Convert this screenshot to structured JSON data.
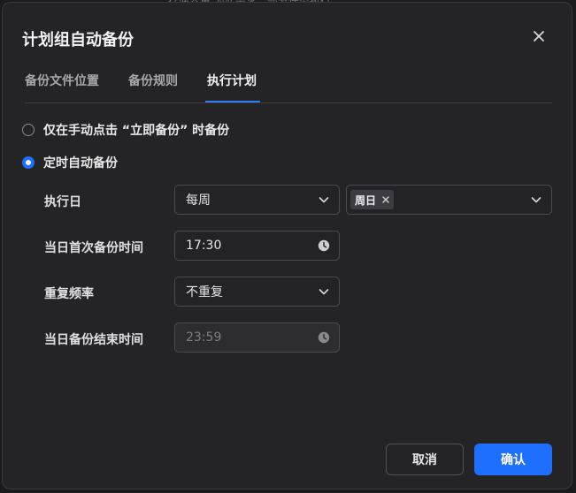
{
  "background_text": "存储容量 为此需求，部分任务执行",
  "dialog": {
    "title": "计划组自动备份",
    "close_icon": "close-icon"
  },
  "tabs": [
    {
      "label": "备份文件位置",
      "active": false
    },
    {
      "label": "备份规则",
      "active": false
    },
    {
      "label": "执行计划",
      "active": true
    }
  ],
  "options": {
    "manual": {
      "label": "仅在手动点击 “立即备份” 时备份",
      "checked": false
    },
    "scheduled": {
      "label": "定时自动备份",
      "checked": true
    }
  },
  "fields": {
    "execution_day": {
      "label": "执行日",
      "frequency_value": "每周",
      "days_selected": [
        "周日"
      ]
    },
    "first_backup_time": {
      "label": "当日首次备份时间",
      "value": "17:30"
    },
    "repeat_frequency": {
      "label": "重复频率",
      "value": "不重复"
    },
    "end_time": {
      "label": "当日备份结束时间",
      "value": "23:59",
      "disabled": true
    }
  },
  "buttons": {
    "cancel": "取消",
    "confirm": "确认"
  },
  "colors": {
    "accent": "#1f6fff",
    "dialog_bg": "#242426",
    "border": "#4b4b4f"
  }
}
